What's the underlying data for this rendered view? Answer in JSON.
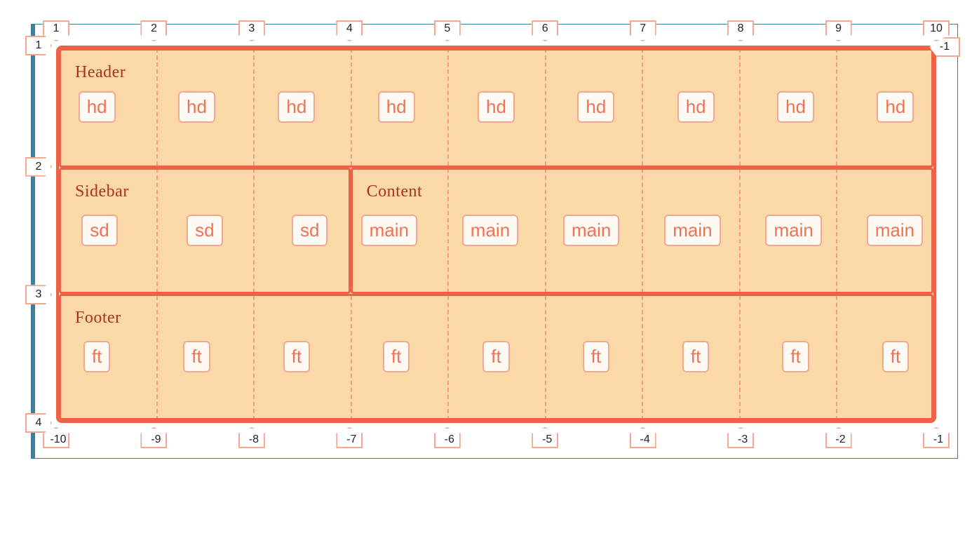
{
  "columns_top": [
    "1",
    "2",
    "3",
    "4",
    "5",
    "6",
    "7",
    "8",
    "9",
    "10"
  ],
  "columns_bottom": [
    "-10",
    "-9",
    "-8",
    "-7",
    "-6",
    "-5",
    "-4",
    "-3",
    "-2",
    "-1"
  ],
  "rows_left": [
    "1",
    "2",
    "3",
    "4"
  ],
  "neg1_label": "-1",
  "areas": {
    "header": {
      "name": "Header",
      "tag": "hd",
      "count": 9
    },
    "sidebar": {
      "name": "Sidebar",
      "tag": "sd",
      "count": 3
    },
    "content": {
      "name": "Content",
      "tag": "main",
      "count": 6
    },
    "footer": {
      "name": "Footer",
      "tag": "ft",
      "count": 9
    }
  }
}
